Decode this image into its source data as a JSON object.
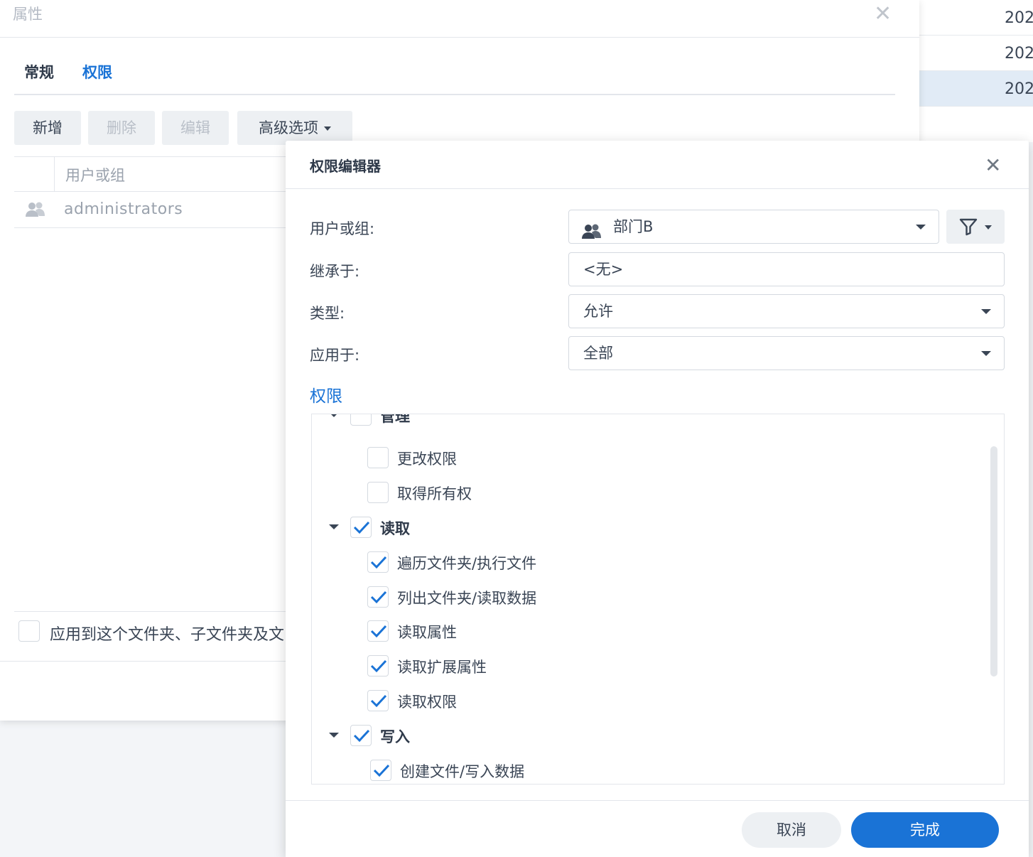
{
  "background_list": {
    "rows": [
      "202",
      "202",
      "202"
    ]
  },
  "properties": {
    "title": "属性",
    "tabs": {
      "general": "常规",
      "permissions": "权限"
    },
    "toolbar": {
      "add": "新增",
      "delete": "删除",
      "edit": "编辑",
      "advanced": "高级选项"
    },
    "grid": {
      "header": "用户或组",
      "rows": [
        "administrators"
      ]
    },
    "apply_label": "应用到这个文件夹、子文件夹及文"
  },
  "editor": {
    "title": "权限编辑器",
    "fields": {
      "user_label": "用户或组:",
      "user_value": "部门B",
      "inherit_label": "继承于:",
      "inherit_value": "<无>",
      "type_label": "类型:",
      "type_value": "允许",
      "apply_label": "应用于:",
      "apply_value": "全部"
    },
    "perm_heading": "权限",
    "tree": {
      "partial": "管理",
      "items": [
        {
          "label": "更改权限",
          "checked": false
        },
        {
          "label": "取得所有权",
          "checked": false
        },
        {
          "label": "读取",
          "checked": true
        },
        {
          "label": "遍历文件夹/执行文件",
          "checked": true
        },
        {
          "label": "列出文件夹/读取数据",
          "checked": true
        },
        {
          "label": "读取属性",
          "checked": true
        },
        {
          "label": "读取扩展属性",
          "checked": true
        },
        {
          "label": "读取权限",
          "checked": true
        },
        {
          "label": "写入",
          "checked": true
        },
        {
          "label": "创建文件/写入数据",
          "checked": true
        }
      ]
    },
    "buttons": {
      "cancel": "取消",
      "done": "完成"
    }
  },
  "colors": {
    "accent": "#1a73d6",
    "check": "#1a73d6"
  }
}
